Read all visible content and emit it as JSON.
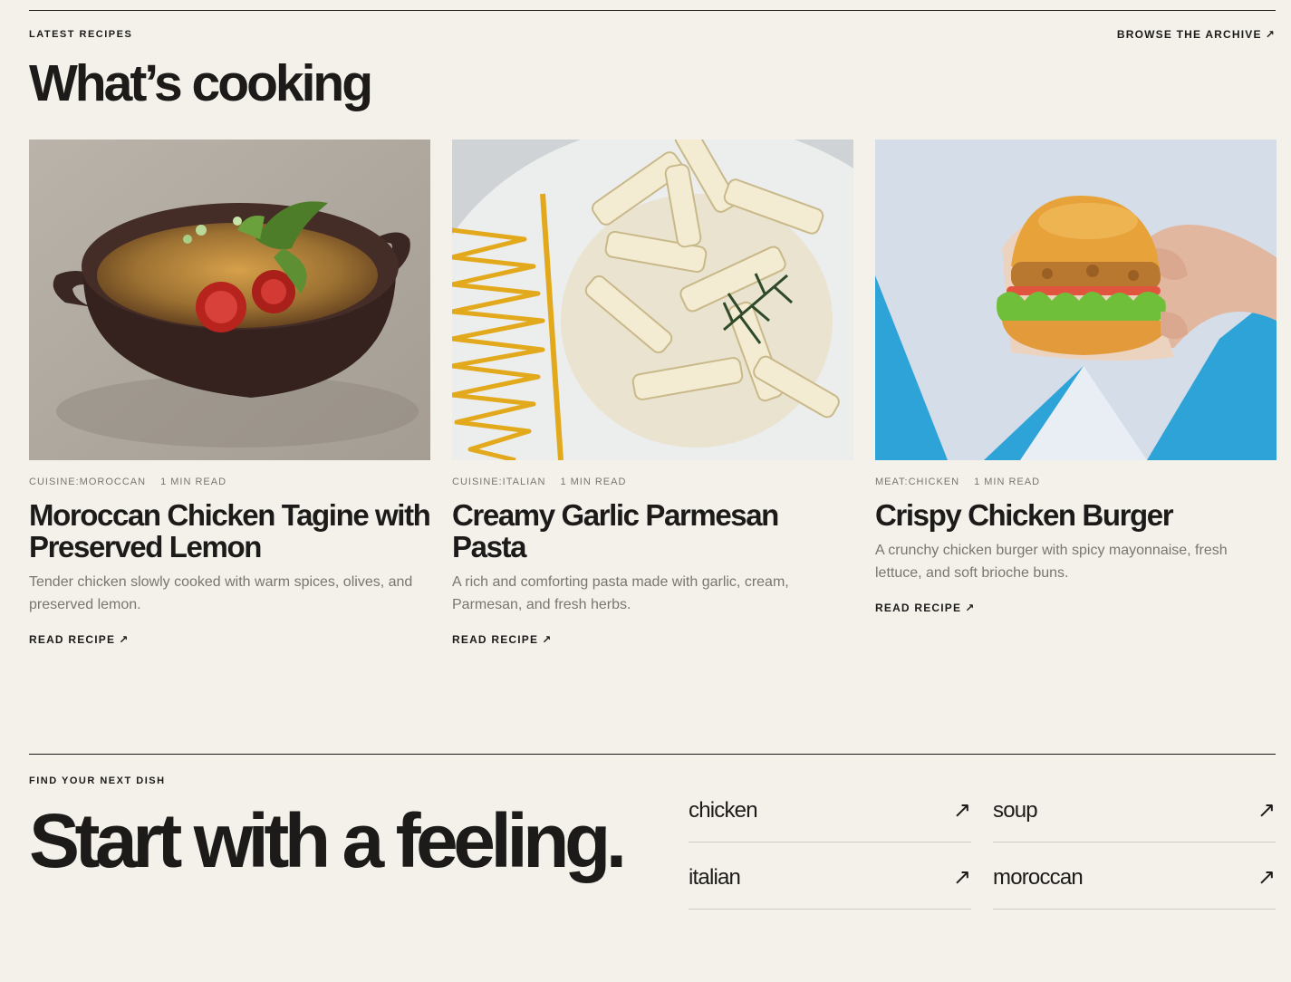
{
  "latest": {
    "eyebrow": "LATEST RECIPES",
    "archive_label": "BROWSE THE ARCHIVE",
    "title": "What’s cooking"
  },
  "arrow_glyph": "↗",
  "recipes": [
    {
      "category": "CUISINE:MOROCCAN",
      "read_time": "1 MIN READ",
      "title": "Moroccan Chicken Tagine with Preserved Lemon",
      "description": "Tender chicken slowly cooked with warm spices, olives, and preserved lemon.",
      "cta": "READ RECIPE"
    },
    {
      "category": "CUISINE:ITALIAN",
      "read_time": "1 MIN READ",
      "title": "Creamy Garlic Parmesan Pasta",
      "description": "A rich and comforting pasta made with garlic, cream, Parmesan, and fresh herbs.",
      "cta": "READ RECIPE"
    },
    {
      "category": "MEAT:CHICKEN",
      "read_time": "1 MIN READ",
      "title": "Crispy Chicken Burger",
      "description": "A crunchy chicken burger with spicy mayonnaise, fresh lettuce, and soft brioche buns.",
      "cta": "READ RECIPE"
    }
  ],
  "discover": {
    "eyebrow": "FIND YOUR NEXT DISH",
    "headline": "Start with a feeling.",
    "tags": [
      "chicken",
      "soup",
      "italian",
      "moroccan"
    ]
  },
  "colors": {
    "background": "#f4f1eb",
    "ink": "#1c1b19",
    "muted": "#7a756f"
  }
}
